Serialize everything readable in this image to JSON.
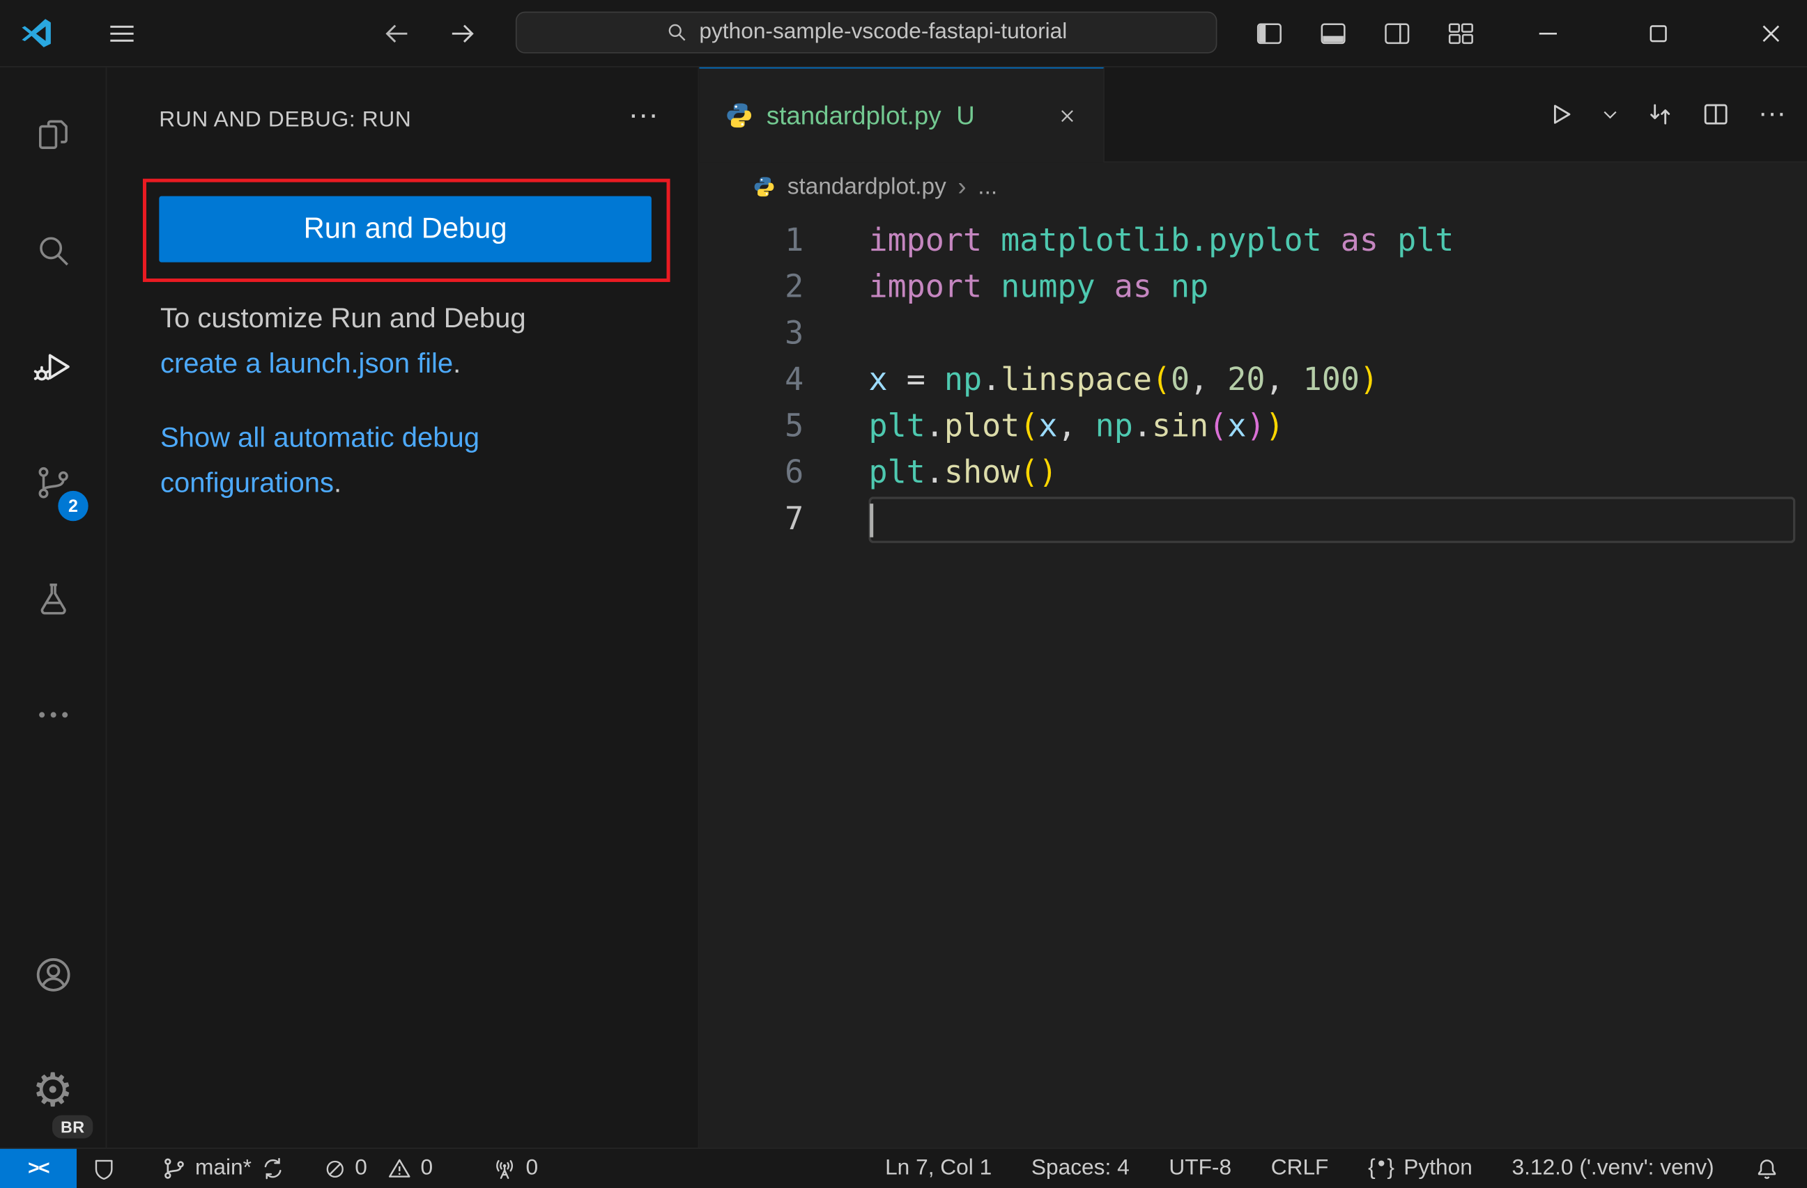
{
  "colors": {
    "accent_blue": "#0078d4",
    "link_blue": "#4daafc",
    "annotation_red": "#ea1b22",
    "untracked_green": "#73C991",
    "bg_dark": "#181818",
    "bg_editor": "#1f1f1f"
  },
  "icons": {
    "ellipsis": "···",
    "gear": "⚙",
    "remote": "><",
    "breadcrumb_separator": "›"
  },
  "window": {
    "command_center": "python-sample-vscode-fastapi-tutorial"
  },
  "activity_bar": {
    "source_control_badge": "2",
    "profile_badge": "BR"
  },
  "sidebar": {
    "header": "RUN AND DEBUG: RUN",
    "run_button": "Run and Debug",
    "customize_line1": "To customize Run and Debug",
    "customize_link": "create a launch.json file",
    "customize_period": ".",
    "auto_configs_link": "Show all automatic debug configurations",
    "auto_configs_period": "."
  },
  "editor": {
    "tab": {
      "file": "standardplot.py",
      "git_status": "U"
    },
    "breadcrumb": {
      "file": "standardplot.py",
      "more": "..."
    },
    "code": {
      "active_line": 7,
      "lines": [
        [
          {
            "t": "import",
            "c": "kw"
          },
          {
            "t": " ",
            "c": "pl"
          },
          {
            "t": "matplotlib.pyplot",
            "c": "mod"
          },
          {
            "t": " ",
            "c": "pl"
          },
          {
            "t": "as",
            "c": "kw"
          },
          {
            "t": " ",
            "c": "pl"
          },
          {
            "t": "plt",
            "c": "mod"
          }
        ],
        [
          {
            "t": "import",
            "c": "kw"
          },
          {
            "t": " ",
            "c": "pl"
          },
          {
            "t": "numpy",
            "c": "mod"
          },
          {
            "t": " ",
            "c": "pl"
          },
          {
            "t": "as",
            "c": "kw"
          },
          {
            "t": " ",
            "c": "pl"
          },
          {
            "t": "np",
            "c": "mod"
          }
        ],
        [],
        [
          {
            "t": "x",
            "c": "var"
          },
          {
            "t": " = ",
            "c": "pl"
          },
          {
            "t": "np",
            "c": "mod"
          },
          {
            "t": ".",
            "c": "pl"
          },
          {
            "t": "linspace",
            "c": "fn"
          },
          {
            "t": "(",
            "c": "b1"
          },
          {
            "t": "0",
            "c": "num"
          },
          {
            "t": ", ",
            "c": "pl"
          },
          {
            "t": "20",
            "c": "num"
          },
          {
            "t": ", ",
            "c": "pl"
          },
          {
            "t": "100",
            "c": "num"
          },
          {
            "t": ")",
            "c": "b1"
          }
        ],
        [
          {
            "t": "plt",
            "c": "mod"
          },
          {
            "t": ".",
            "c": "pl"
          },
          {
            "t": "plot",
            "c": "fn"
          },
          {
            "t": "(",
            "c": "b1"
          },
          {
            "t": "x",
            "c": "var"
          },
          {
            "t": ", ",
            "c": "pl"
          },
          {
            "t": "np",
            "c": "mod"
          },
          {
            "t": ".",
            "c": "pl"
          },
          {
            "t": "sin",
            "c": "fn"
          },
          {
            "t": "(",
            "c": "b2"
          },
          {
            "t": "x",
            "c": "var"
          },
          {
            "t": ")",
            "c": "b2"
          },
          {
            "t": ")",
            "c": "b1"
          }
        ],
        [
          {
            "t": "plt",
            "c": "mod"
          },
          {
            "t": ".",
            "c": "pl"
          },
          {
            "t": "show",
            "c": "fn"
          },
          {
            "t": "(",
            "c": "b1"
          },
          {
            "t": ")",
            "c": "b1"
          }
        ],
        []
      ]
    }
  },
  "status_bar": {
    "branch": "main*",
    "errors": "0",
    "warnings": "0",
    "ports": "0",
    "cursor": "Ln 7, Col 1",
    "indentation": "Spaces: 4",
    "encoding": "UTF-8",
    "eol": "CRLF",
    "language": "Python",
    "interpreter": "3.12.0 ('.venv': venv)"
  }
}
